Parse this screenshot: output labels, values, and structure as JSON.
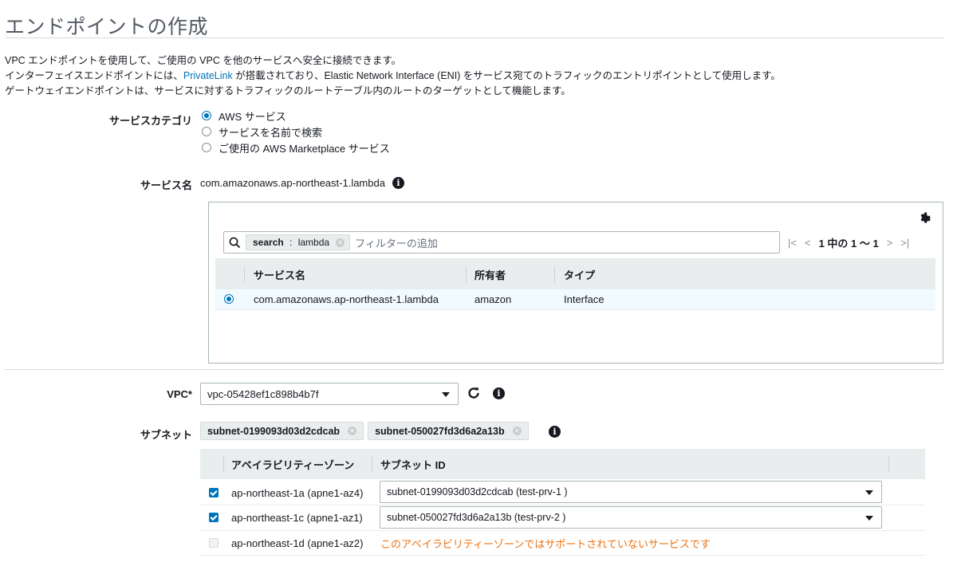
{
  "page": {
    "title": "エンドポイントの作成",
    "desc_line1": "VPC エンドポイントを使用して、ご使用の VPC を他のサービスへ安全に接続できます。",
    "desc_line2_pre": "インターフェイスエンドポイントには、",
    "desc_line2_link": "PrivateLink",
    "desc_line2_post": " が搭載されており、Elastic Network Interface (ENI) をサービス宛てのトラフィックのエントリポイントとして使用します。",
    "desc_line3": "ゲートウェイエンドポイントは、サービスに対するトラフィックのルートテーブル内のルートのターゲットとして機能します。"
  },
  "service_category": {
    "label": "サービスカテゴリ",
    "options": [
      {
        "label": "AWS サービス",
        "selected": true
      },
      {
        "label": "サービスを名前で検索",
        "selected": false
      },
      {
        "label": "ご使用の AWS Marketplace サービス",
        "selected": false
      }
    ]
  },
  "service_name": {
    "label": "サービス名",
    "value": "com.amazonaws.ap-northeast-1.lambda"
  },
  "service_table": {
    "search_token_key": "search",
    "search_token_sep": " : ",
    "search_token_value": "lambda",
    "search_placeholder": "フィルターの追加",
    "pager_text": "1 中の 1 ～ 1",
    "columns": [
      "サービス名",
      "所有者",
      "タイプ"
    ],
    "rows": [
      {
        "name": "com.amazonaws.ap-northeast-1.lambda",
        "owner": "amazon",
        "type": "Interface",
        "selected": true
      }
    ]
  },
  "vpc": {
    "label": "VPC*",
    "value": "vpc-05428ef1c898b4b7f"
  },
  "subnet": {
    "label": "サブネット",
    "chips": [
      "subnet-0199093d03d2cdcab",
      "subnet-050027fd3d6a2a13b"
    ],
    "columns": [
      "アベイラビリティーゾーン",
      "サブネット ID"
    ],
    "rows": [
      {
        "az": "ap-northeast-1a (apne1-az4)",
        "subnet": "subnet-0199093d03d2cdcab (test-prv-1 )",
        "checked": true
      },
      {
        "az": "ap-northeast-1c (apne1-az1)",
        "subnet": "subnet-050027fd3d6a2a13b (test-prv-2 )",
        "checked": true
      },
      {
        "az": "ap-northeast-1d (apne1-az2)",
        "message": "このアベイラビリティーゾーンではサポートされていないサービスです",
        "checked": false
      }
    ]
  },
  "colors": {
    "accent": "#0073bb",
    "warning": "#ec7211"
  },
  "icons": {
    "info": "info-icon",
    "gear": "gear-icon",
    "search": "search-icon",
    "refresh": "refresh-icon"
  }
}
